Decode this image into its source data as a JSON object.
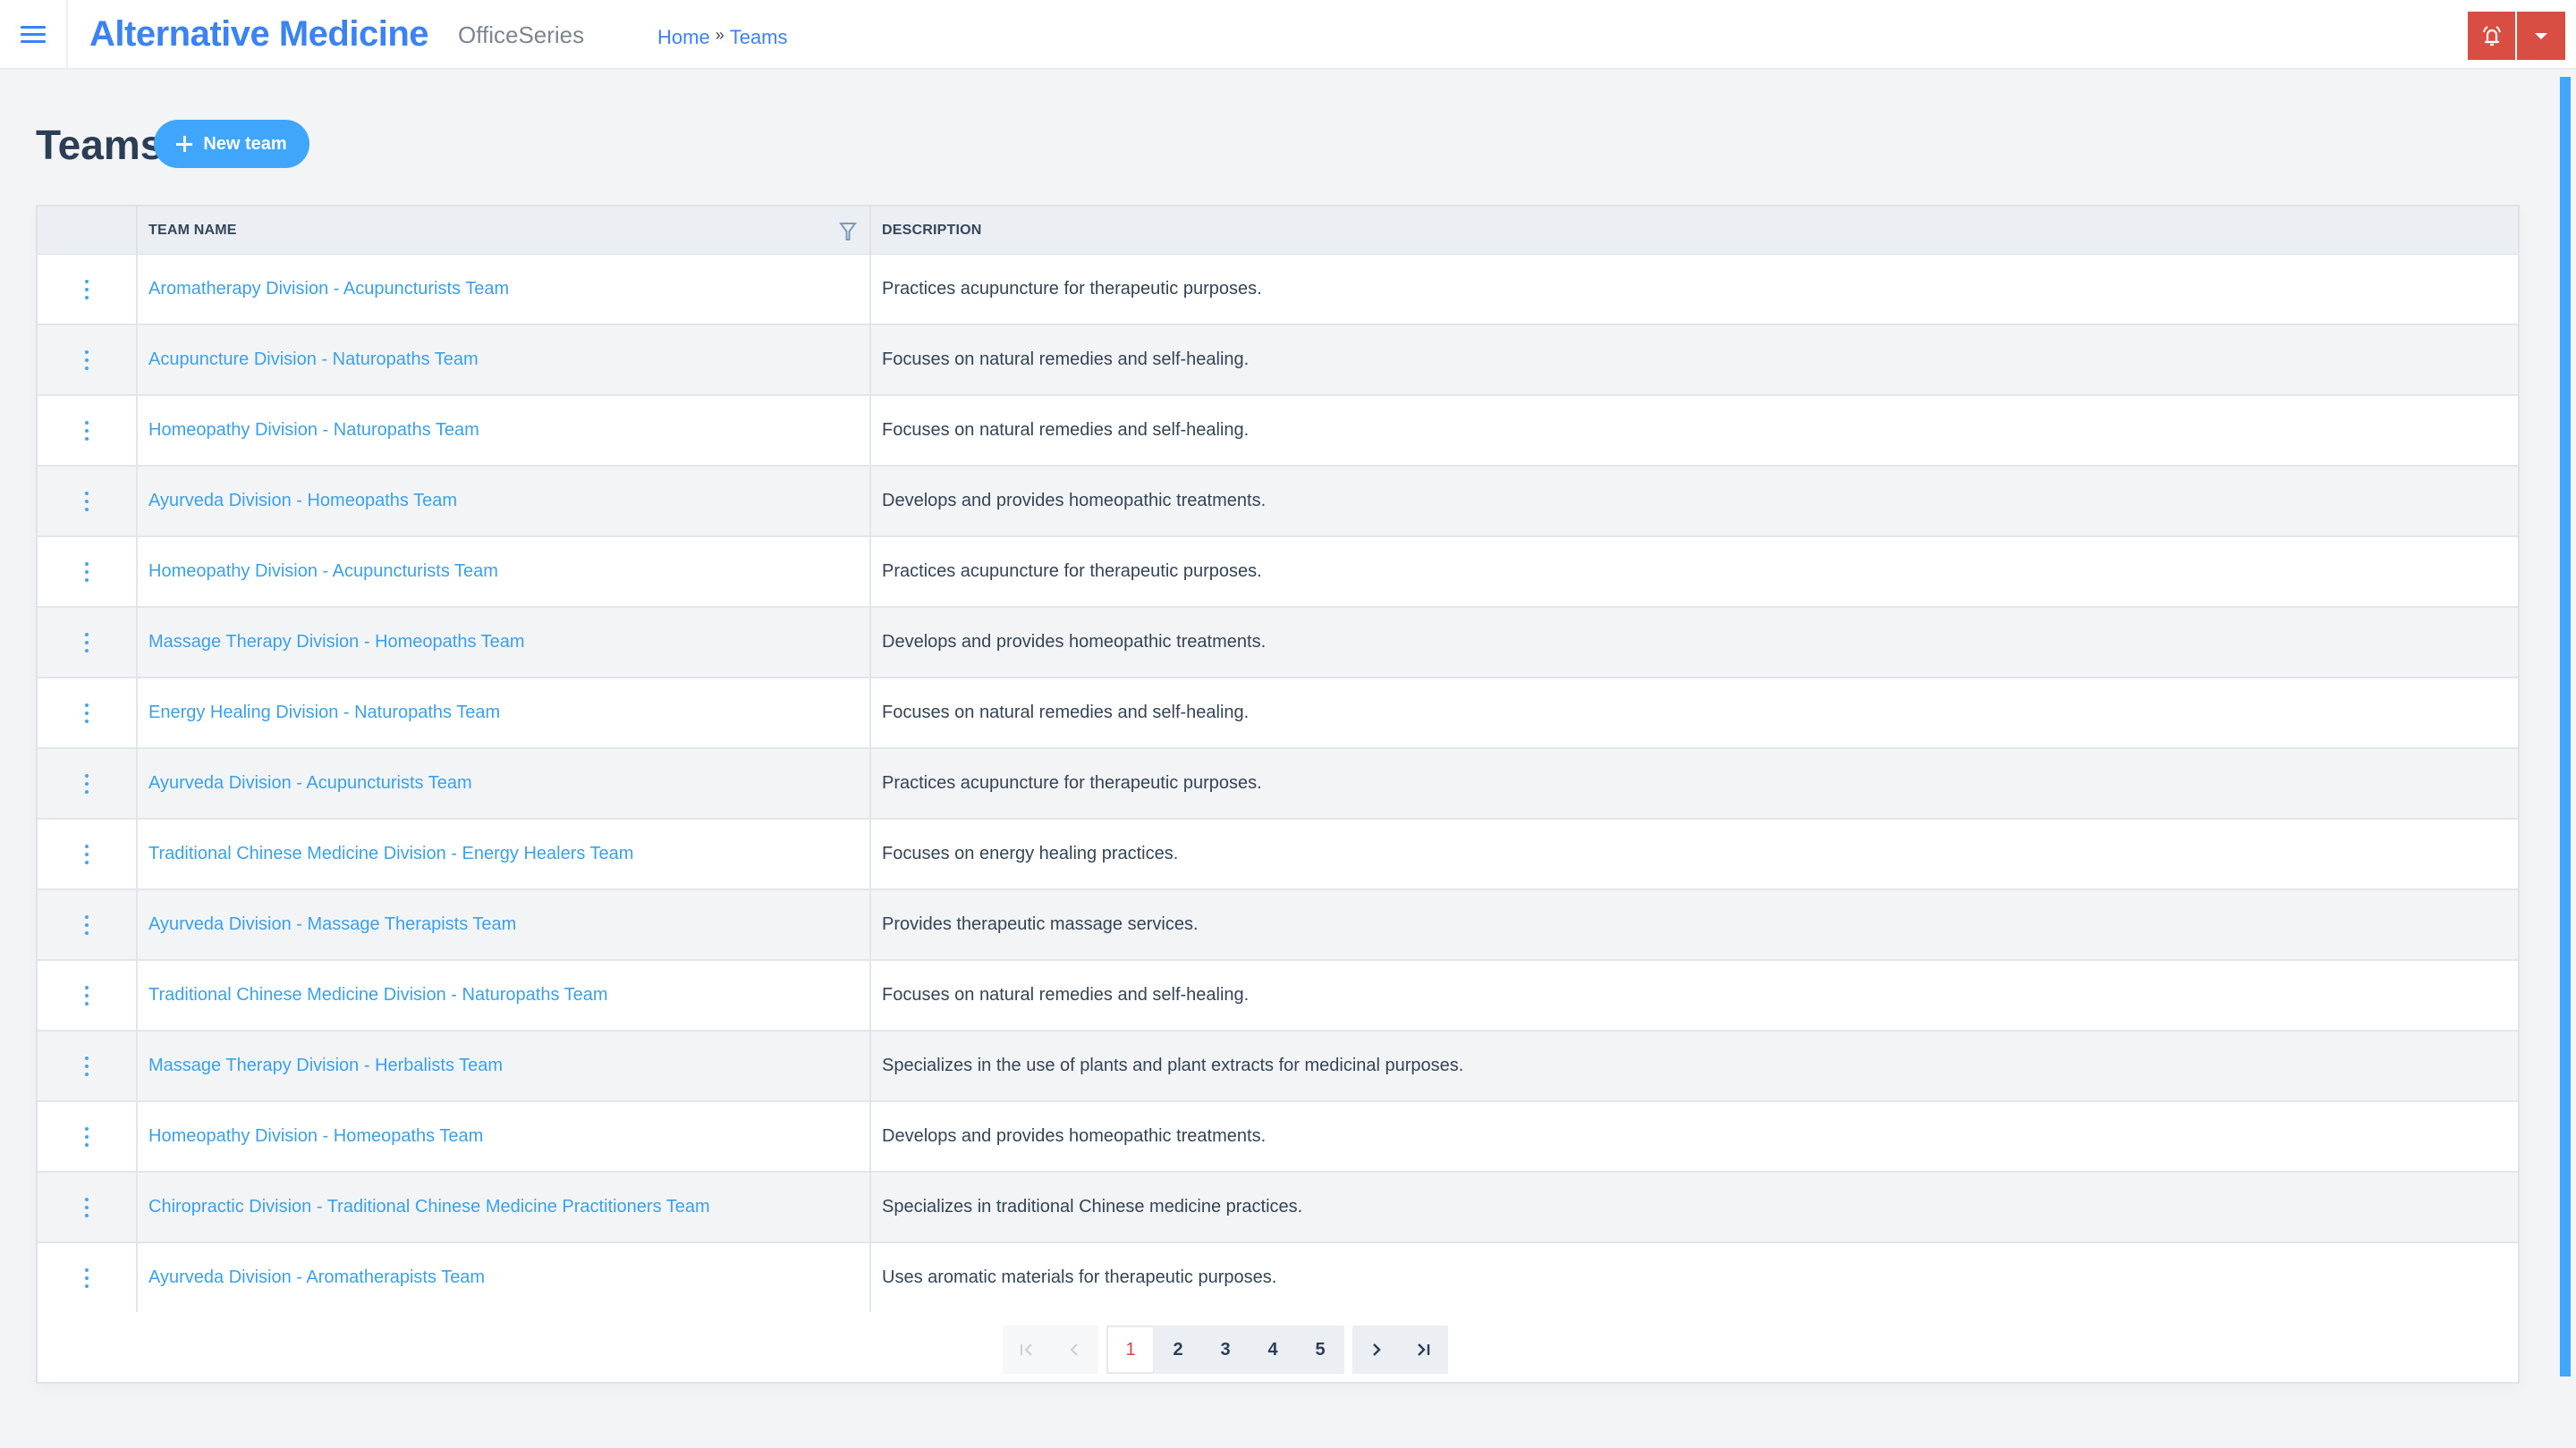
{
  "app": {
    "title": "Alternative Medicine",
    "subtitle": "OfficeSeries"
  },
  "breadcrumb": {
    "items": [
      "Home",
      "Teams"
    ],
    "separator": "»"
  },
  "header_actions": {
    "alert_icon": "bell-ringing-icon",
    "dropdown_icon": "caret-down-icon",
    "accent_color": "#d94e43"
  },
  "page": {
    "title": "Teams",
    "new_button_label": "New team",
    "accent_color": "#3fa6fb"
  },
  "table": {
    "columns": {
      "actions": "",
      "name": "TEAM NAME",
      "description": "DESCRIPTION"
    },
    "rows": [
      {
        "name": "Aromatherapy Division - Acupuncturists Team",
        "description": "Practices acupuncture for therapeutic purposes."
      },
      {
        "name": "Acupuncture Division - Naturopaths Team",
        "description": "Focuses on natural remedies and self-healing."
      },
      {
        "name": "Homeopathy Division - Naturopaths Team",
        "description": "Focuses on natural remedies and self-healing."
      },
      {
        "name": "Ayurveda Division - Homeopaths Team",
        "description": "Develops and provides homeopathic treatments."
      },
      {
        "name": "Homeopathy Division - Acupuncturists Team",
        "description": "Practices acupuncture for therapeutic purposes."
      },
      {
        "name": "Massage Therapy Division - Homeopaths Team",
        "description": "Develops and provides homeopathic treatments."
      },
      {
        "name": "Energy Healing Division - Naturopaths Team",
        "description": "Focuses on natural remedies and self-healing."
      },
      {
        "name": "Ayurveda Division - Acupuncturists Team",
        "description": "Practices acupuncture for therapeutic purposes."
      },
      {
        "name": "Traditional Chinese Medicine Division - Energy Healers Team",
        "description": "Focuses on energy healing practices."
      },
      {
        "name": "Ayurveda Division - Massage Therapists Team",
        "description": "Provides therapeutic massage services."
      },
      {
        "name": "Traditional Chinese Medicine Division - Naturopaths Team",
        "description": "Focuses on natural remedies and self-healing."
      },
      {
        "name": "Massage Therapy Division - Herbalists Team",
        "description": "Specializes in the use of plants and plant extracts for medicinal purposes."
      },
      {
        "name": "Homeopathy Division - Homeopaths Team",
        "description": "Develops and provides homeopathic treatments."
      },
      {
        "name": "Chiropractic Division - Traditional Chinese Medicine Practitioners Team",
        "description": "Specializes in traditional Chinese medicine practices."
      },
      {
        "name": "Ayurveda Division - Aromatherapists Team",
        "description": "Uses aromatic materials for therapeutic purposes."
      }
    ]
  },
  "pagination": {
    "first_label": "|<",
    "prev_label": "<",
    "pages": [
      "1",
      "2",
      "3",
      "4",
      "5"
    ],
    "current_page": "1",
    "next_label": ">",
    "last_label": ">|"
  }
}
